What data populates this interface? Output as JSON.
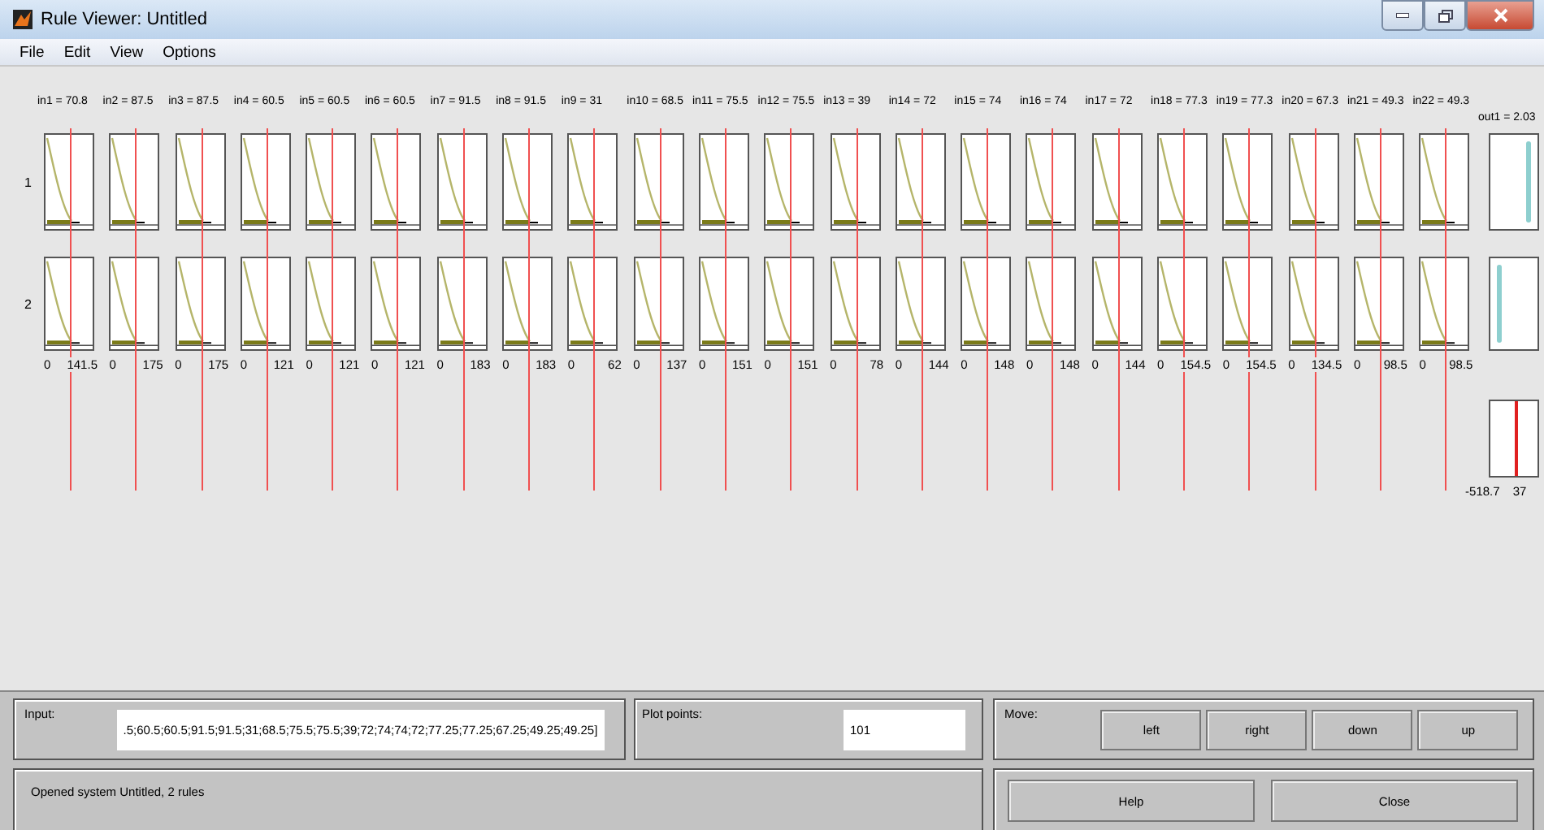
{
  "window": {
    "title": "Rule Viewer: Untitled"
  },
  "menu": [
    "File",
    "Edit",
    "View",
    "Options"
  ],
  "rule_numbers": [
    "1",
    "2"
  ],
  "inputs": [
    {
      "label": "in1 = 70.8",
      "min": "0",
      "max": "141.5"
    },
    {
      "label": "in2 = 87.5",
      "min": "0",
      "max": "175"
    },
    {
      "label": "in3 = 87.5",
      "min": "0",
      "max": "175"
    },
    {
      "label": "in4 = 60.5",
      "min": "0",
      "max": "121"
    },
    {
      "label": "in5 = 60.5",
      "min": "0",
      "max": "121"
    },
    {
      "label": "in6 = 60.5",
      "min": "0",
      "max": "121"
    },
    {
      "label": "in7 = 91.5",
      "min": "0",
      "max": "183"
    },
    {
      "label": "in8 = 91.5",
      "min": "0",
      "max": "183"
    },
    {
      "label": "in9 = 31",
      "min": "0",
      "max": "62"
    },
    {
      "label": "in10 = 68.5",
      "min": "0",
      "max": "137"
    },
    {
      "label": "in11 = 75.5",
      "min": "0",
      "max": "151"
    },
    {
      "label": "in12 = 75.5",
      "min": "0",
      "max": "151"
    },
    {
      "label": "in13 = 39",
      "min": "0",
      "max": "78"
    },
    {
      "label": "in14 = 72",
      "min": "0",
      "max": "144"
    },
    {
      "label": "in15 = 74",
      "min": "0",
      "max": "148"
    },
    {
      "label": "in16 = 74",
      "min": "0",
      "max": "148"
    },
    {
      "label": "in17 = 72",
      "min": "0",
      "max": "144"
    },
    {
      "label": "in18 = 77.3",
      "min": "0",
      "max": "154.5"
    },
    {
      "label": "in19 = 77.3",
      "min": "0",
      "max": "154.5"
    },
    {
      "label": "in20 = 67.3",
      "min": "0",
      "max": "134.5"
    },
    {
      "label": "in21 = 49.3",
      "min": "0",
      "max": "98.5"
    },
    {
      "label": "in22 = 49.3",
      "min": "0",
      "max": "98.5"
    }
  ],
  "output": {
    "label": "out1 = 2.03",
    "min": "-518.7",
    "max": "37"
  },
  "input_field": {
    "label": "Input:",
    "value": ".5;60.5;60.5;91.5;91.5;31;68.5;75.5;75.5;39;72;74;74;72;77.25;77.25;67.25;49.25;49.25]"
  },
  "plot_points": {
    "label": "Plot points:",
    "value": "101"
  },
  "move": {
    "label": "Move:",
    "buttons": [
      "left",
      "right",
      "down",
      "up"
    ]
  },
  "status": "Opened system Untitled, 2 rules",
  "buttons": [
    "Help",
    "Close"
  ]
}
